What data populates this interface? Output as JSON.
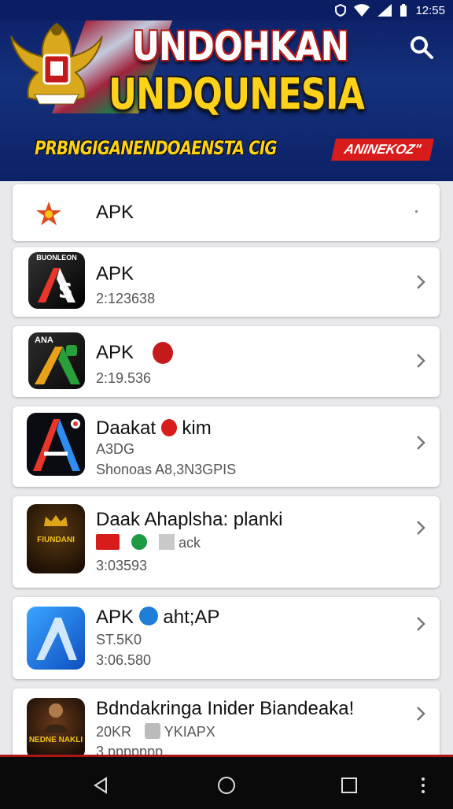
{
  "status_bar": {
    "time": "12:55"
  },
  "header": {
    "title_line1": "UNDOHKAN",
    "title_line2": "UNDQUNESIA",
    "subtitle": "PRBNGIGANENDOAENSTA CIG",
    "tag": "ANINEKOZ\""
  },
  "list": [
    {
      "name": "APK"
    },
    {
      "name": "APK",
      "line1": "2:123638",
      "icon_text": "BUONLEON"
    },
    {
      "name": "APK",
      "line1": "2:19.536",
      "icon_text": "ANA"
    },
    {
      "name": "Daakat",
      "name_suffix": "kim",
      "line1": "A3DG",
      "line2": "Shonoas  A8,3N3GPIS"
    },
    {
      "name": "Daak Ahaplsha: planki",
      "line1_suffix": "ack",
      "line2": "3:03593",
      "icon_text": "FIUNDANI"
    },
    {
      "name": "APK",
      "name_suffix": "aht;AP",
      "line1": "ST.5K0",
      "line2": "3:06.580"
    },
    {
      "name": "Bdndakringa Inider Biandeaka!",
      "line1": "20KR",
      "line1_suffix": "YKIAPX",
      "line2": "3 ppppppp",
      "icon_text": "NEDNE NAKLI"
    }
  ],
  "colors": {
    "header_bg": "#0c1e63",
    "title_yellow": "#ffd21a",
    "tag_red": "#d81c1c",
    "navbar": "#0a0a0a"
  }
}
